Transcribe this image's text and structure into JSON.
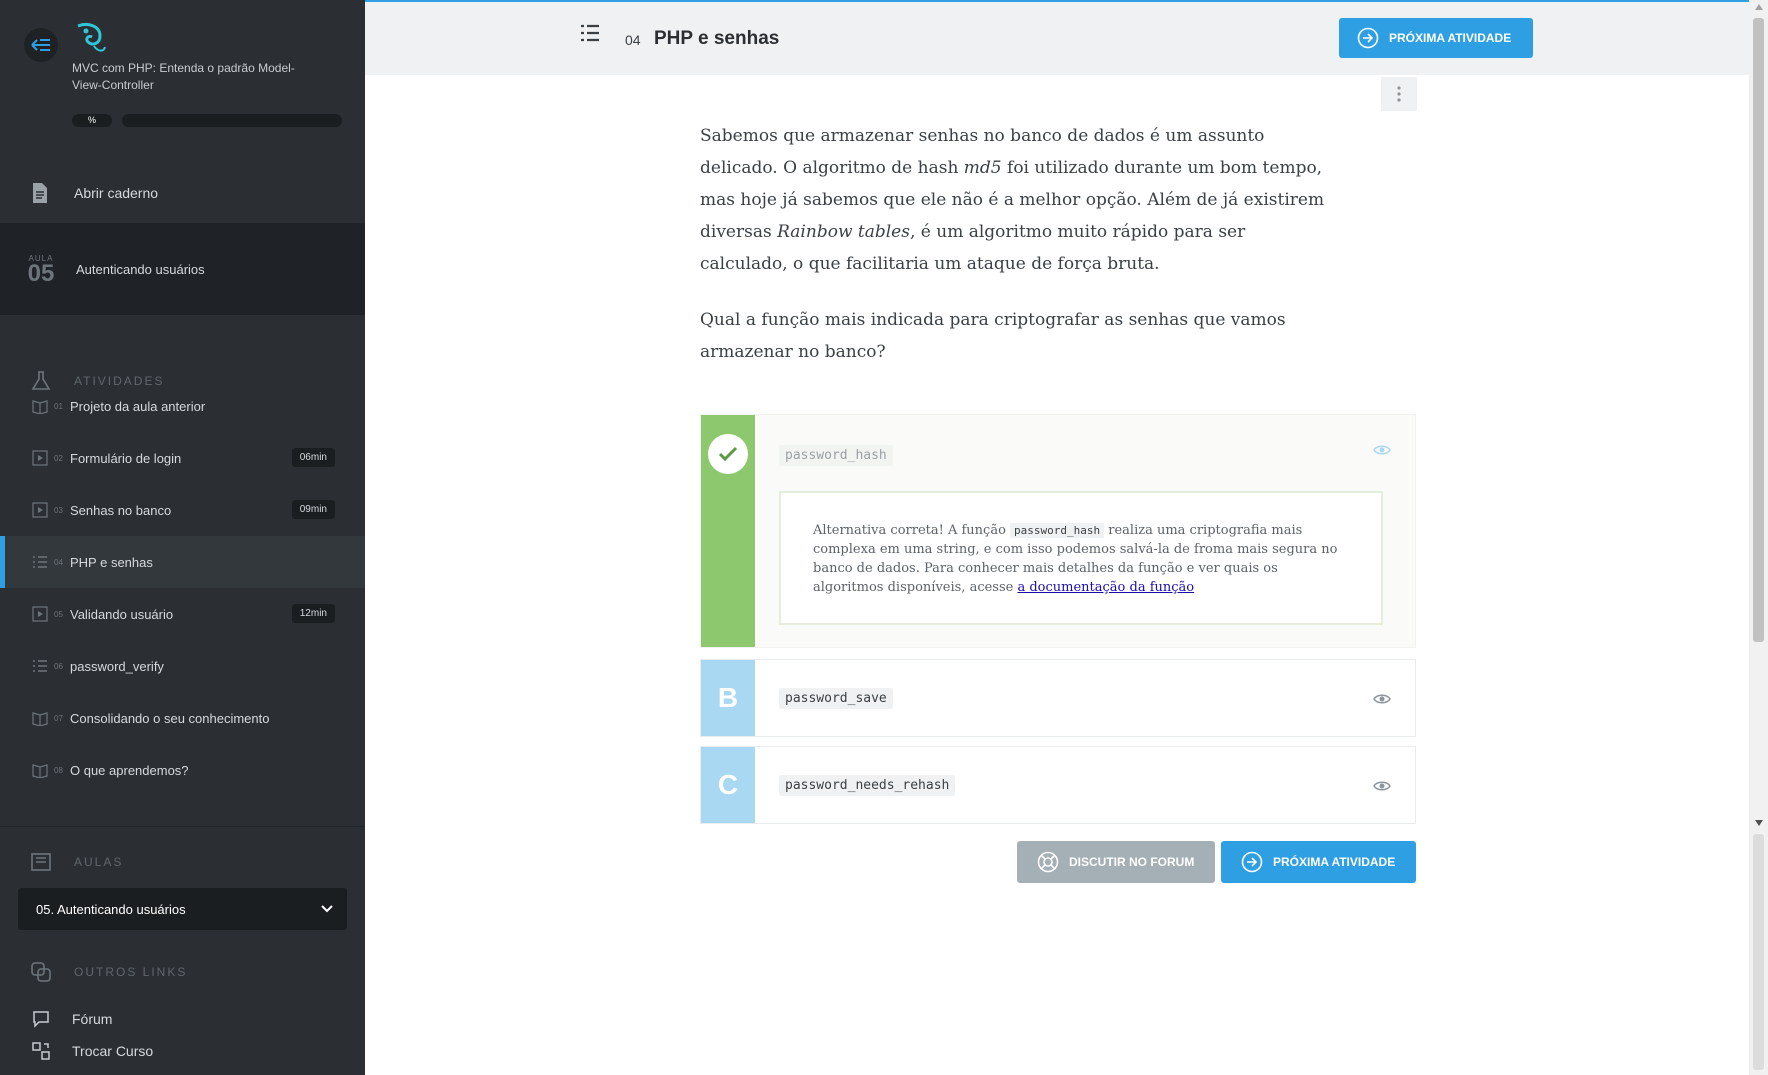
{
  "sidebar": {
    "course_title": "MVC com PHP: Entenda o padrão Model-View-Controller",
    "progress_label": "%",
    "progress_fraction": 0,
    "notebook_label": "Abrir caderno",
    "lesson": {
      "kicker": "AULA",
      "number": "05",
      "title": "Autenticando usuários"
    },
    "activities_heading": "ATIVIDADES",
    "activities": [
      {
        "num": "01",
        "label": "Projeto da aula anterior",
        "duration": "",
        "icon": "book-icon"
      },
      {
        "num": "02",
        "label": "Formulário de login",
        "duration": "06min",
        "icon": "video-icon"
      },
      {
        "num": "03",
        "label": "Senhas no banco",
        "duration": "09min",
        "icon": "video-icon"
      },
      {
        "num": "04",
        "label": "PHP e senhas",
        "duration": "",
        "icon": "list-icon"
      },
      {
        "num": "05",
        "label": "Validando usuário",
        "duration": "12min",
        "icon": "video-icon"
      },
      {
        "num": "06",
        "label": "password_verify",
        "duration": "",
        "icon": "list-icon"
      },
      {
        "num": "07",
        "label": "Consolidando o seu conhecimento",
        "duration": "",
        "icon": "book-icon"
      },
      {
        "num": "08",
        "label": "O que aprendemos?",
        "duration": "",
        "icon": "book-icon"
      }
    ],
    "aulas_heading": "AULAS",
    "aulas_selected": "05. Autenticando usuários",
    "links_heading": "OUTROS LINKS",
    "links": [
      {
        "label": "Fórum",
        "icon": "forum-icon"
      },
      {
        "label": "Trocar Curso",
        "icon": "switch-course-icon"
      }
    ]
  },
  "topbar": {
    "activity_number": "04",
    "activity_title": "PHP e senhas",
    "next_label": "PRÓXIMA ATIVIDADE"
  },
  "content": {
    "p1_a": "Sabemos que armazenar senhas no banco de dados é um assunto delicado. O algoritmo de hash ",
    "p1_em1": "md5",
    "p1_b": " foi utilizado durante um bom tempo, mas hoje já sabemos que ele não é a melhor opção. Além de já existirem diversas ",
    "p1_em2": "Rainbow tables",
    "p1_c": ", é um algoritmo muito rápido para ser calculado, o que facilitaria um ataque de força bruta.",
    "p2": "Qual a função mais indicada para criptografar as senhas que vamos armazenar no banco?"
  },
  "alternatives": {
    "a": {
      "code": "password_hash",
      "feedback_a": "Alternativa correta! A função ",
      "feedback_code": "password_hash",
      "feedback_b": " realiza uma criptografia mais complexa em uma string, e com isso podemos salvá-la de froma mais segura no banco de dados. Para conhecer mais detalhes da função e ver quais os algoritmos disponíveis, acesse ",
      "feedback_link": "a documentação da função"
    },
    "b": {
      "letter": "B",
      "code": "password_save"
    },
    "c": {
      "letter": "C",
      "code": "password_needs_rehash"
    }
  },
  "footer_buttons": {
    "forum_label": "DISCUTIR NO FORUM",
    "next_label": "PRÓXIMA ATIVIDADE"
  },
  "colors": {
    "accent": "#2f9fe3",
    "sidebar_bg": "#2b2f33",
    "correct": "#8dc86e",
    "option": "#a9d8f2"
  }
}
